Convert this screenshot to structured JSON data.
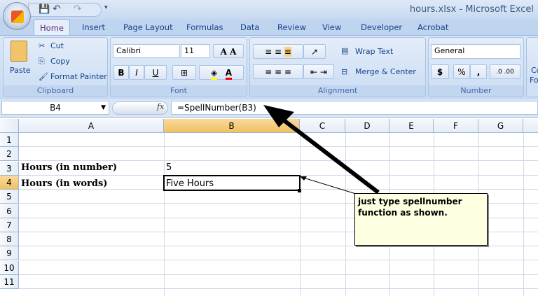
{
  "window": {
    "title": "hours.xlsx - Microsoft Excel"
  },
  "tabs": [
    "Home",
    "Insert",
    "Page Layout",
    "Formulas",
    "Data",
    "Review",
    "View",
    "Developer",
    "Acrobat"
  ],
  "clipboard": {
    "paste": "Paste",
    "cut": "Cut",
    "copy": "Copy",
    "format_painter": "Format Painter",
    "label": "Clipboard"
  },
  "font": {
    "name": "Calibri",
    "size": "11",
    "bold": "B",
    "italic": "I",
    "underline": "U",
    "label": "Font"
  },
  "alignment": {
    "wrap_text": "Wrap Text",
    "merge_center": "Merge & Center",
    "label": "Alignment"
  },
  "number": {
    "format": "General",
    "currency": "$",
    "percent": "%",
    "comma": ",",
    "label": "Number"
  },
  "styles": {
    "partial": "Co",
    "partial2": "Fo"
  },
  "formula_bar": {
    "name_box": "B4",
    "fx": "fx",
    "formula": "=SpellNumber(B3)"
  },
  "columns": [
    "A",
    "B",
    "C",
    "D",
    "E",
    "F",
    "G"
  ],
  "rows": [
    "1",
    "2",
    "3",
    "4",
    "5",
    "6",
    "7",
    "8",
    "9",
    "10",
    "11"
  ],
  "cells": {
    "A3": "Hours (in number)",
    "B3": "5",
    "A4": "Hours (in words)",
    "B4": "Five Hours"
  },
  "comment": "just type spellnumber function as shown.",
  "colors": {
    "selected_header": "#f1c15f",
    "comment_bg": "#ffffe1"
  }
}
